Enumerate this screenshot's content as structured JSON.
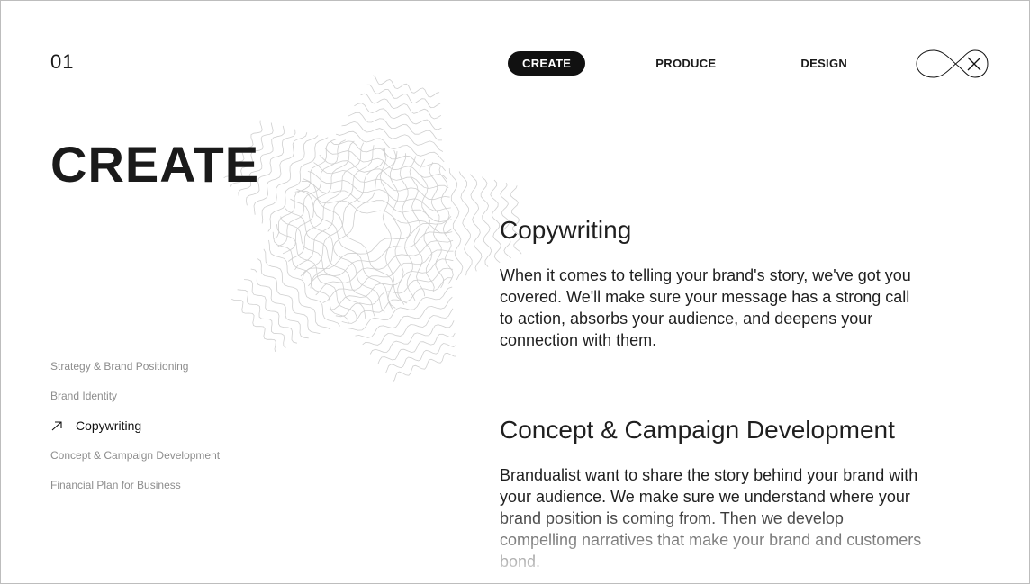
{
  "section_number": "01",
  "nav": {
    "items": [
      {
        "label": "CREATE",
        "active": true
      },
      {
        "label": "PRODUCE",
        "active": false
      },
      {
        "label": "DESIGN",
        "active": false
      }
    ],
    "close_icon": "infinity-close-icon"
  },
  "hero_title": "CREATE",
  "sidebar": {
    "items": [
      {
        "label": "Strategy & Brand Positioning",
        "active": false
      },
      {
        "label": "Brand Identity",
        "active": false
      },
      {
        "label": "Copywriting",
        "active": true
      },
      {
        "label": "Concept & Campaign Development",
        "active": false
      },
      {
        "label": "Financial Plan for Business",
        "active": false
      }
    ],
    "active_icon": "arrow-up-right-icon"
  },
  "content": {
    "sections": [
      {
        "title": "Copywriting",
        "body": "When it comes to telling your brand's story, we've got you covered. We'll make sure your message has a strong call to action, absorbs your audience, and deepens your connection with them."
      },
      {
        "title": "Concept & Campaign Development",
        "body": "Brandualist want to share the story behind your brand with your audience. We make sure we understand where your brand position is coming from. Then we develop compelling narratives that make your brand and customers bond."
      }
    ]
  },
  "colors": {
    "accent": "#111111",
    "muted_text": "#8d8d8d",
    "star_lines": "#cfcfcf"
  }
}
